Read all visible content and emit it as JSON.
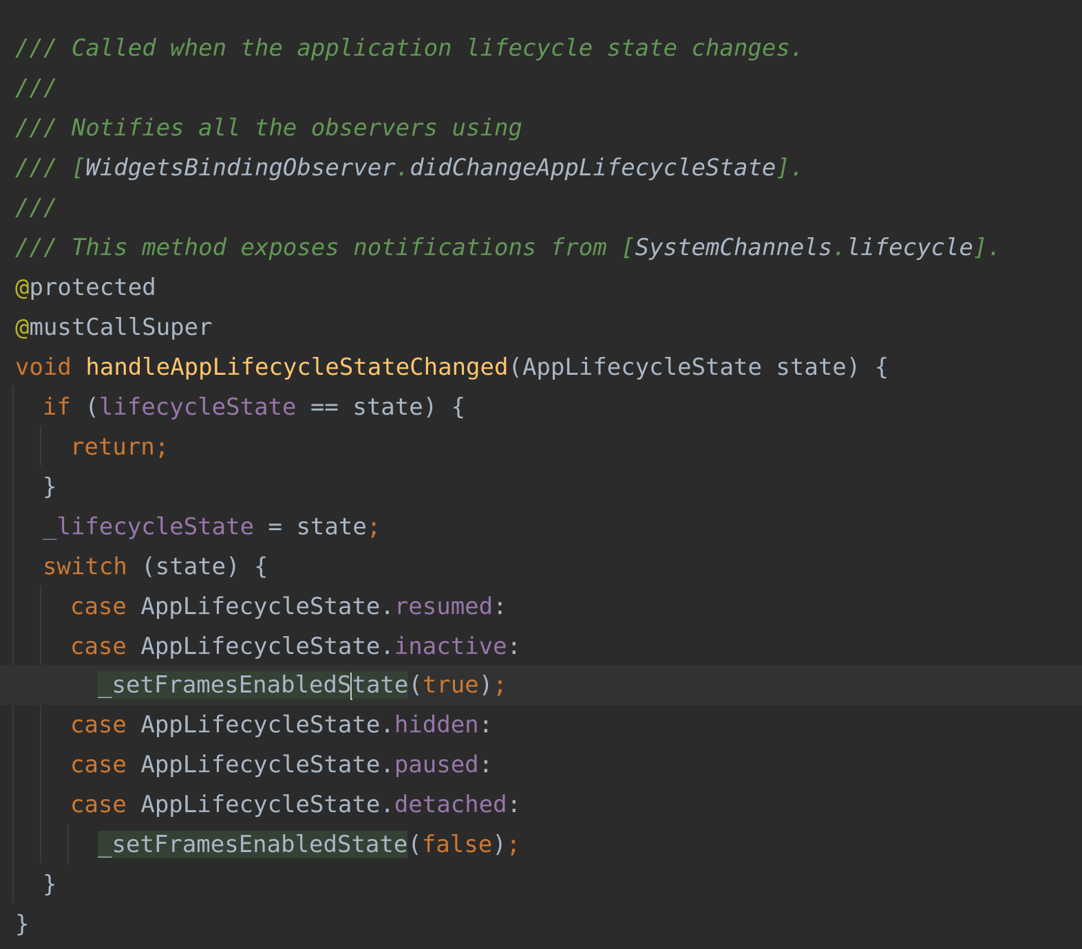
{
  "editor": {
    "language": "Dart",
    "colors": {
      "background": "#2b2b2b",
      "current_line": "#323232",
      "comment": "#629755",
      "keyword": "#cc7832",
      "function": "#ffc66d",
      "field": "#9876aa",
      "annotation": "#bbb529",
      "text": "#a9b7c6",
      "usage_highlight": "#344134"
    },
    "lines": [
      {
        "tokens": [
          {
            "t": "/// Called when the application lifecycle state changes.",
            "k": "comment"
          }
        ]
      },
      {
        "tokens": [
          {
            "t": "///",
            "k": "comment"
          }
        ]
      },
      {
        "tokens": [
          {
            "t": "/// Notifies all the observers using",
            "k": "comment"
          }
        ]
      },
      {
        "tokens": [
          {
            "t": "/// [",
            "k": "comment"
          },
          {
            "t": "WidgetsBindingObserver",
            "k": "docref"
          },
          {
            "t": ".",
            "k": "comment"
          },
          {
            "t": "didChangeAppLifecycleState",
            "k": "docref"
          },
          {
            "t": "].",
            "k": "comment"
          }
        ]
      },
      {
        "tokens": [
          {
            "t": "///",
            "k": "comment"
          }
        ]
      },
      {
        "tokens": [
          {
            "t": "/// This method exposes notifications from [",
            "k": "comment"
          },
          {
            "t": "SystemChannels",
            "k": "docref"
          },
          {
            "t": ".",
            "k": "comment"
          },
          {
            "t": "lifecycle",
            "k": "docref"
          },
          {
            "t": "].",
            "k": "comment"
          }
        ]
      },
      {
        "tokens": [
          {
            "t": "@",
            "k": "annotation-at"
          },
          {
            "t": "protected",
            "k": "annotation"
          }
        ]
      },
      {
        "tokens": [
          {
            "t": "@",
            "k": "annotation-at"
          },
          {
            "t": "mustCallSuper",
            "k": "annotation"
          }
        ]
      },
      {
        "tokens": [
          {
            "t": "void",
            "k": "keyword"
          },
          {
            "t": " ",
            "k": "punct"
          },
          {
            "t": "handleAppLifecycleStateChanged",
            "k": "function"
          },
          {
            "t": "(",
            "k": "punct"
          },
          {
            "t": "AppLifecycleState",
            "k": "type"
          },
          {
            "t": " state) {",
            "k": "param"
          }
        ]
      },
      {
        "tokens": [
          {
            "t": "if",
            "k": "keyword"
          },
          {
            "t": " (",
            "k": "punct"
          },
          {
            "t": "lifecycleState",
            "k": "field"
          },
          {
            "t": " == state) {",
            "k": "ident"
          }
        ]
      },
      {
        "tokens": [
          {
            "t": "return",
            "k": "keyword"
          },
          {
            "t": ";",
            "k": "semicolon"
          }
        ]
      },
      {
        "tokens": [
          {
            "t": "}",
            "k": "punct"
          }
        ]
      },
      {
        "tokens": [
          {
            "t": "_lifecycleState",
            "k": "field"
          },
          {
            "t": " = state",
            "k": "ident"
          },
          {
            "t": ";",
            "k": "semicolon"
          }
        ]
      },
      {
        "tokens": [
          {
            "t": "switch",
            "k": "keyword"
          },
          {
            "t": " (state) {",
            "k": "ident"
          }
        ]
      },
      {
        "tokens": [
          {
            "t": "case",
            "k": "keyword"
          },
          {
            "t": " AppLifecycleState.",
            "k": "type"
          },
          {
            "t": "resumed",
            "k": "field"
          },
          {
            "t": ":",
            "k": "punct"
          }
        ]
      },
      {
        "tokens": [
          {
            "t": "case",
            "k": "keyword"
          },
          {
            "t": " AppLifecycleState.",
            "k": "type"
          },
          {
            "t": "inactive",
            "k": "field"
          },
          {
            "t": ":",
            "k": "punct"
          }
        ]
      },
      {
        "tokens": [
          {
            "t": "_setFramesEnabledS",
            "k": "call"
          },
          {
            "t": "",
            "k": "caret"
          },
          {
            "t": "tate",
            "k": "call"
          },
          {
            "t": "(",
            "k": "punct"
          },
          {
            "t": "true",
            "k": "literal"
          },
          {
            "t": ")",
            "k": "punct"
          },
          {
            "t": ";",
            "k": "semicolon"
          }
        ]
      },
      {
        "tokens": [
          {
            "t": "case",
            "k": "keyword"
          },
          {
            "t": " AppLifecycleState.",
            "k": "type"
          },
          {
            "t": "hidden",
            "k": "field"
          },
          {
            "t": ":",
            "k": "punct"
          }
        ]
      },
      {
        "tokens": [
          {
            "t": "case",
            "k": "keyword"
          },
          {
            "t": " AppLifecycleState.",
            "k": "type"
          },
          {
            "t": "paused",
            "k": "field"
          },
          {
            "t": ":",
            "k": "punct"
          }
        ]
      },
      {
        "tokens": [
          {
            "t": "case",
            "k": "keyword"
          },
          {
            "t": " AppLifecycleState.",
            "k": "type"
          },
          {
            "t": "detached",
            "k": "field"
          },
          {
            "t": ":",
            "k": "punct"
          }
        ]
      },
      {
        "tokens": [
          {
            "t": "_setFramesEnabledState",
            "k": "call"
          },
          {
            "t": "(",
            "k": "punct"
          },
          {
            "t": "false",
            "k": "literal"
          },
          {
            "t": ")",
            "k": "punct"
          },
          {
            "t": ";",
            "k": "semicolon"
          }
        ]
      },
      {
        "tokens": [
          {
            "t": "}",
            "k": "punct"
          }
        ]
      },
      {
        "tokens": [
          {
            "t": "}",
            "k": "punct"
          }
        ]
      }
    ]
  }
}
